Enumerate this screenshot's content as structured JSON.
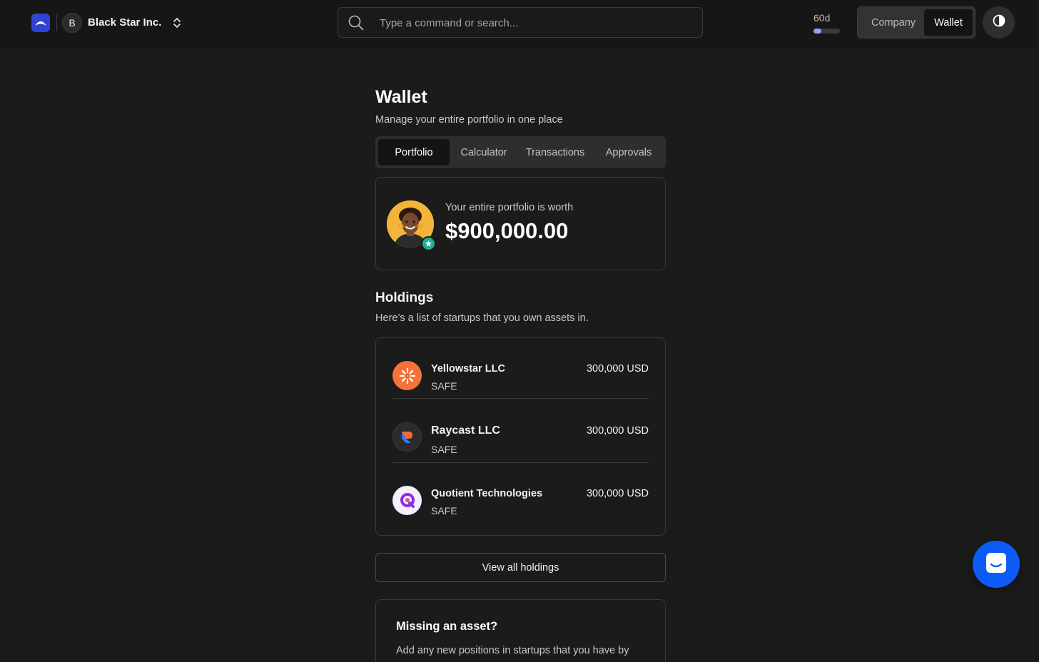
{
  "header": {
    "org_initial": "B",
    "org_name": "Black Star Inc.",
    "search_placeholder": "Type a command or search...",
    "trial_label": "60d",
    "trial_progress": 0.3,
    "mode_options": [
      "Company",
      "Wallet"
    ],
    "mode_selected": "Wallet"
  },
  "wallet": {
    "title": "Wallet",
    "subtitle": "Manage your entire portfolio in one place",
    "tabs": [
      {
        "label": "Portfolio",
        "active": true
      },
      {
        "label": "Calculator",
        "active": false
      },
      {
        "label": "Transactions",
        "active": false
      },
      {
        "label": "Approvals",
        "active": false
      }
    ],
    "worth_label": "Your entire portfolio is worth",
    "worth_value": "$900,000.00"
  },
  "holdings": {
    "title": "Holdings",
    "subtitle": "Here’s a list of startups that you own assets in.",
    "items": [
      {
        "name": "Yellowstar LLC",
        "type": "SAFE",
        "amount": "300,000 USD",
        "logo": "yellowstar-logo-icon"
      },
      {
        "name": "Raycast LLC",
        "type": "SAFE",
        "amount": "300,000 USD",
        "logo": "raycast-logo-icon"
      },
      {
        "name": "Quotient Technologies",
        "type": "SAFE",
        "amount": "300,000 USD",
        "logo": "quotient-logo-icon"
      }
    ],
    "view_all_label": "View all holdings"
  },
  "missing": {
    "title": "Missing an asset?",
    "text": "Add any new positions in startups that you have by"
  },
  "colors": {
    "background": "#1b1b1b",
    "accent_blue": "#0b5cf6",
    "logo_blue": "#3043d6",
    "yellowstar_orange": "#f5733a",
    "badge_teal": "#1fae9a"
  }
}
